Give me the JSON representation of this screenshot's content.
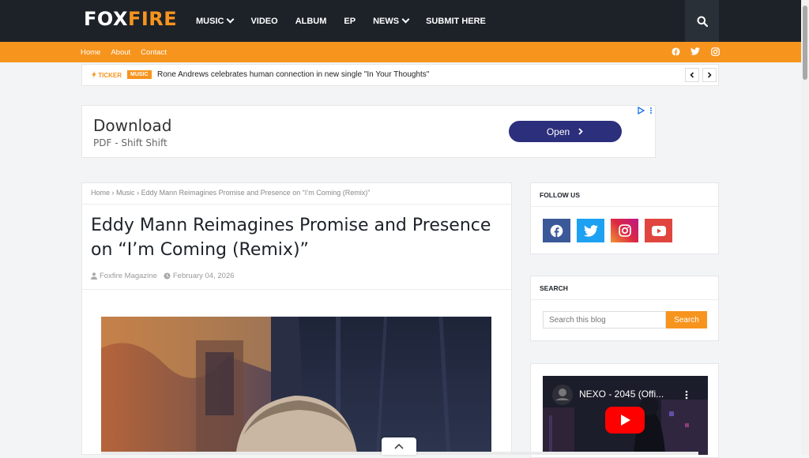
{
  "logo": {
    "part1": "FOX",
    "part2": "FIRE"
  },
  "nav": [
    {
      "label": "MUSIC",
      "dropdown": true
    },
    {
      "label": "VIDEO",
      "dropdown": false
    },
    {
      "label": "ALBUM",
      "dropdown": false
    },
    {
      "label": "EP",
      "dropdown": false
    },
    {
      "label": "NEWS",
      "dropdown": true
    },
    {
      "label": "SUBMIT HERE",
      "dropdown": false
    }
  ],
  "subnav": [
    "Home",
    "About",
    "Contact"
  ],
  "ticker": {
    "label": "TICKER",
    "badge": "MUSIC",
    "text": "Rone Andrews celebrates human connection in new single \"In Your Thoughts\""
  },
  "ad": {
    "title": "Download",
    "subtitle": "PDF - Shift Shift",
    "button": "Open"
  },
  "breadcrumb": {
    "home": "Home",
    "sep": "›",
    "section": "Music",
    "current": "Eddy Mann Reimagines Promise and Presence on “I’m Coming (Remix)”"
  },
  "post": {
    "title": "Eddy Mann Reimagines Promise and Presence on “I’m Coming (Remix)”",
    "author": "Foxfire Magazine",
    "date": "February 04, 2026"
  },
  "follow": {
    "title": "FOLLOW US",
    "colors": {
      "facebook": "#3b5998",
      "twitter": "#1da1f2",
      "instagram": "#c13584",
      "youtube": "#e0463f"
    }
  },
  "search": {
    "title": "SEARCH",
    "placeholder": "Search this blog",
    "button": "Search"
  },
  "video": {
    "title": "NEXO - 2045 (Offi..."
  },
  "colors": {
    "accent": "#f7941d",
    "dark": "#1d2229"
  }
}
